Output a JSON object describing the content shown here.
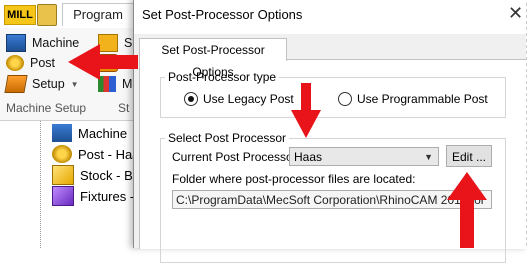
{
  "app": {
    "mill_tab": "MILL",
    "program_tab": "Program",
    "ribbon": {
      "machine": "Machine",
      "post": "Post",
      "setup": "Setup",
      "s_item": "S",
      "m_item": "M",
      "group_label": "Machine Setup",
      "group_label2": "St"
    },
    "tree": {
      "items": [
        {
          "label": "Machine"
        },
        {
          "label": "Post - Haa"
        },
        {
          "label": "Stock - Bo"
        },
        {
          "label": "Fixtures -"
        }
      ]
    }
  },
  "dialog": {
    "title": "Set Post-Processor Options",
    "close_glyph": "✕",
    "tab_label": "Set Post-Processor Options",
    "post_type": {
      "legend": "Post-Processor type",
      "option_legacy": "Use Legacy Post",
      "option_programmable": "Use Programmable Post",
      "selected": "legacy"
    },
    "select_post": {
      "legend": "Select Post Processor",
      "current_label": "Current Post Processor:",
      "current_value": "Haas",
      "edit_button": "Edit ...",
      "folder_label": "Folder where post-processor files are located:",
      "folder_path": "C:\\ProgramData\\MecSoft Corporation\\RhinoCAM 2018 for"
    }
  },
  "colors": {
    "annotation_arrow": "#e8141a",
    "mill_tab": "#f5c518"
  }
}
